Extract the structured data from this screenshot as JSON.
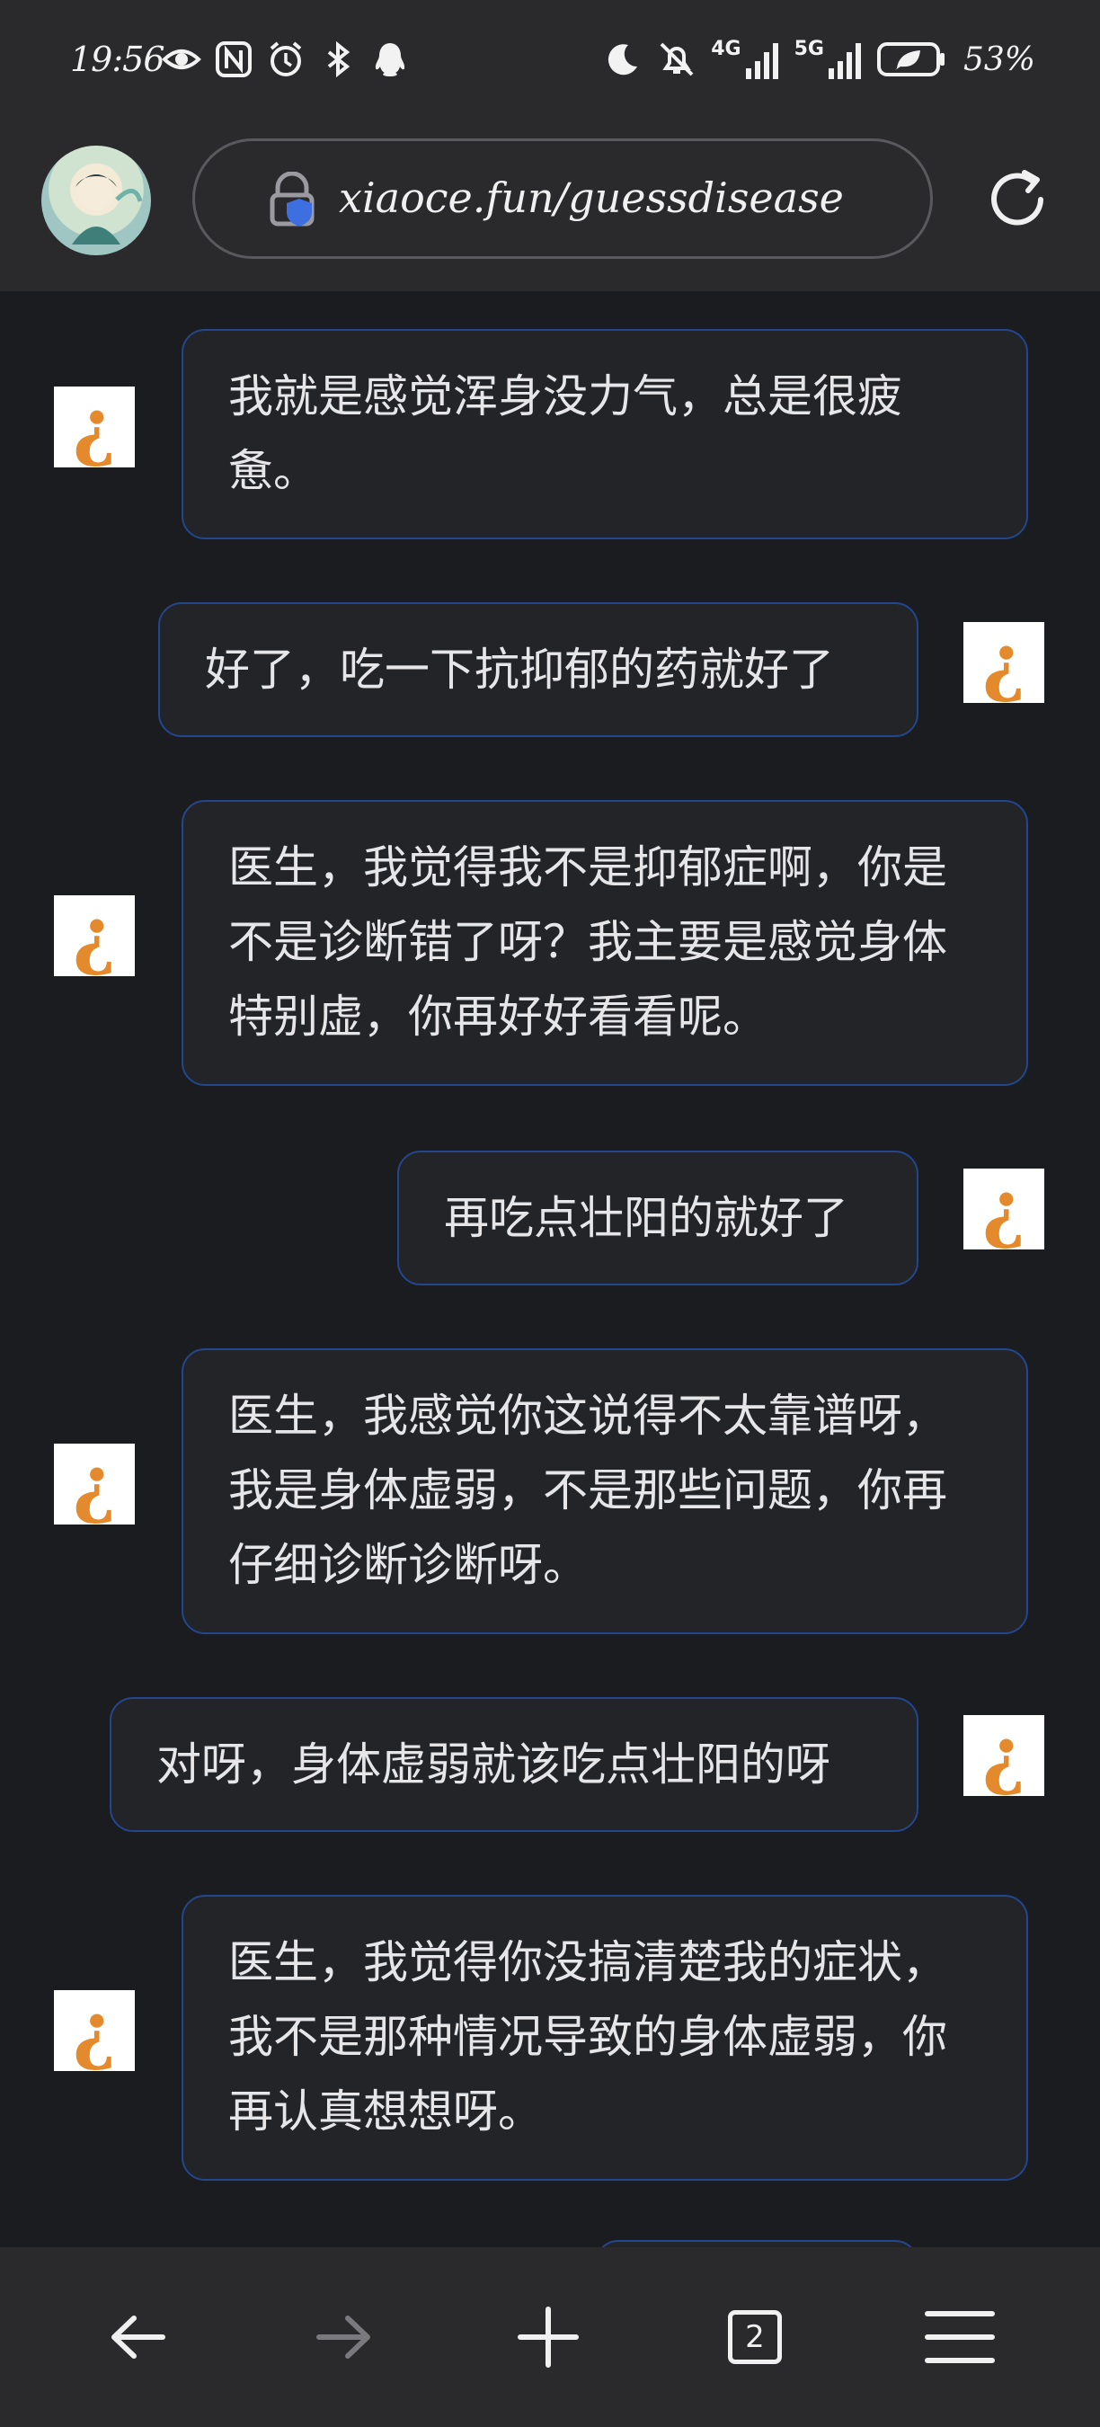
{
  "status_bar": {
    "time": "19:56",
    "left_icons": [
      "eye-icon",
      "nfc-icon",
      "alarm-icon",
      "bluetooth-icon",
      "qq-icon"
    ],
    "right_icons": [
      "moon-icon",
      "mute-icon",
      "signal-4g-icon",
      "signal-5g-icon",
      "battery-icon"
    ],
    "net_4g": "4G",
    "net_5g": "5G",
    "battery_percent": "53%"
  },
  "browser": {
    "url": "xiaoce.fun/guessdisease",
    "tab_count": "2"
  },
  "messages": [
    {
      "side": "left",
      "text": "我就是感觉浑身没力气，总是很疲惫。"
    },
    {
      "side": "right",
      "text": "好了，吃一下抗抑郁的药就好了"
    },
    {
      "side": "left",
      "text": "医生，我觉得我不是抑郁症啊，你是不是诊断错了呀？我主要是感觉身体特别虚，你再好好看看呢。"
    },
    {
      "side": "right",
      "text": "再吃点壮阳的就好了"
    },
    {
      "side": "left",
      "text": "医生，我感觉你这说得不太靠谱呀，我是身体虚弱，不是那些问题，你再仔细诊断诊断呀。"
    },
    {
      "side": "right",
      "text": "对呀，身体虚弱就该吃点壮阳的呀"
    },
    {
      "side": "left",
      "text": "医生，我觉得你没搞清楚我的症状，我不是那种情况导致的身体虚弱，你再认真想想呀。"
    }
  ],
  "avatar_icon": "¿",
  "colors": {
    "background": "#1b1c1f",
    "bars": "#2a2a2d",
    "bubble_border": "#23468c",
    "avatar_accent": "#e48a2c",
    "lock_shield": "#3d6fe0"
  }
}
